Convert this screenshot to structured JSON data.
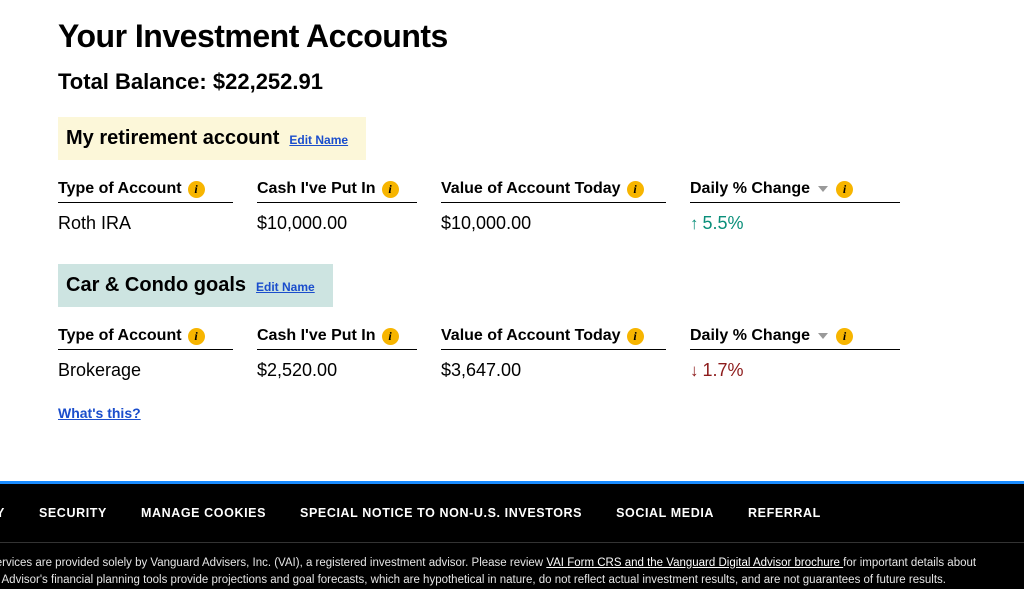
{
  "page": {
    "title": "Your Investment Accounts",
    "total_label": "Total Balance:",
    "total_value": "$22,252.91"
  },
  "headers": {
    "type": "Type of Account",
    "cash": "Cash I've Put In",
    "value": "Value of Account Today",
    "daily": "Daily % Change"
  },
  "accounts": [
    {
      "name": "My retirement account",
      "edit_label": "Edit Name",
      "bg": "yellow",
      "type": "Roth IRA",
      "cash": "$10,000.00",
      "value": "$10,000.00",
      "change_direction": "up",
      "change": "5.5%",
      "whats_this": null
    },
    {
      "name": "Car & Condo goals",
      "edit_label": "Edit Name",
      "bg": "teal",
      "type": "Brokerage",
      "cash": "$2,520.00",
      "value": "$3,647.00",
      "change_direction": "down",
      "change": "1.7%",
      "whats_this": "What's this?"
    }
  ],
  "footer": {
    "nav": [
      "Y",
      "SECURITY",
      "MANAGE COOKIES",
      "SPECIAL NOTICE TO NON-U.S. INVESTORS",
      "SOCIAL MEDIA",
      "REFERRAL"
    ],
    "legal_prefix": "services are provided solely by Vanguard Advisers, Inc. (VAI), a registered investment advisor. Please review ",
    "legal_link": "VAI Form CRS and the Vanguard Digital Advisor brochure ",
    "legal_suffix": "for important details about",
    "legal_line2": "al Advisor's financial planning tools provide projections and goal forecasts, which are hypothetical in nature, do not reflect actual investment results, and are not guarantees of future results."
  }
}
